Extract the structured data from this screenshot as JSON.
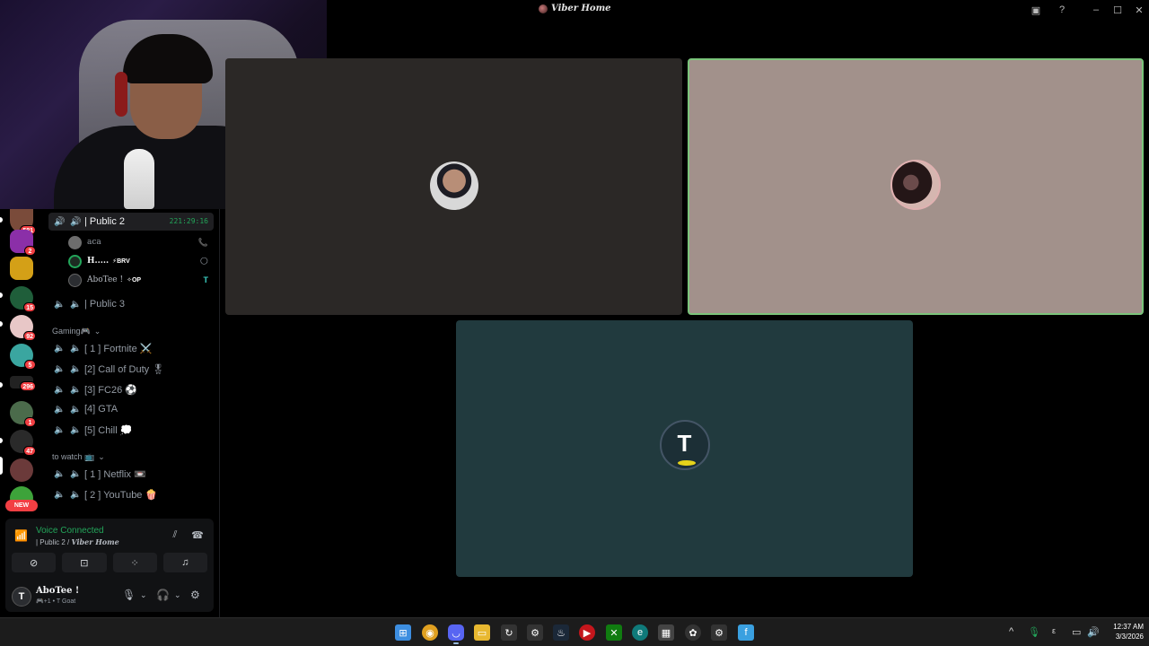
{
  "window": {
    "title": "Viber Home",
    "controls": {
      "minimize": "–",
      "maximize": "☐",
      "close": "✕"
    }
  },
  "servers": [
    {
      "badge": "581",
      "color": "#7a4b3a"
    },
    {
      "badge": "2",
      "color": "#8b2fa8"
    },
    {
      "badge": "",
      "color": "#d4a017"
    },
    {
      "badge": "15",
      "color": "#1f5e3a"
    },
    {
      "badge": "92",
      "color": "#e8c7c7"
    },
    {
      "badge": "5",
      "color": "#3aa6a0"
    },
    {
      "badge": "296",
      "color": "#222"
    },
    {
      "badge": "1",
      "color": "#4b6b4b"
    },
    {
      "badge": "47",
      "color": "#2a2a2a"
    },
    {
      "badge": "",
      "color": "#6b3a3a"
    },
    {
      "badge": "",
      "color": "#3da33a"
    }
  ],
  "new_badge": "NEW",
  "channels": {
    "active": {
      "name": "| Public 2",
      "timer": "221:29:16"
    },
    "members": [
      {
        "name": "aca",
        "tag": "",
        "right": "📞"
      },
      {
        "name": "H.....",
        "tag": "⚡BRV",
        "right": "🌕"
      },
      {
        "name": "AboTee !",
        "tag": "✧OP",
        "right": "T"
      }
    ],
    "public3": "| Public 3",
    "gaming_category": "Gaming🎮",
    "gaming": [
      "[ 1 ] Fortnite ⚔️",
      "[2] Call of Duty 🎖",
      "[3] FC26 ⚽",
      "[4] GTA",
      "[5] Chill 💭"
    ],
    "watch_category": "to watch 📺",
    "watch": [
      "[ 1 ] Netflix 📼",
      "[ 2 ] YouTube 🍿"
    ]
  },
  "voice_panel": {
    "status": "Voice Connected",
    "channel_prefix": "| Public 2 / ",
    "server": "Viber Home",
    "user_name": "AboTee !",
    "user_status": "🎮+1 • T Goat"
  },
  "taskbar": {
    "time": "12:37 AM",
    "date": "3/3/2026"
  }
}
